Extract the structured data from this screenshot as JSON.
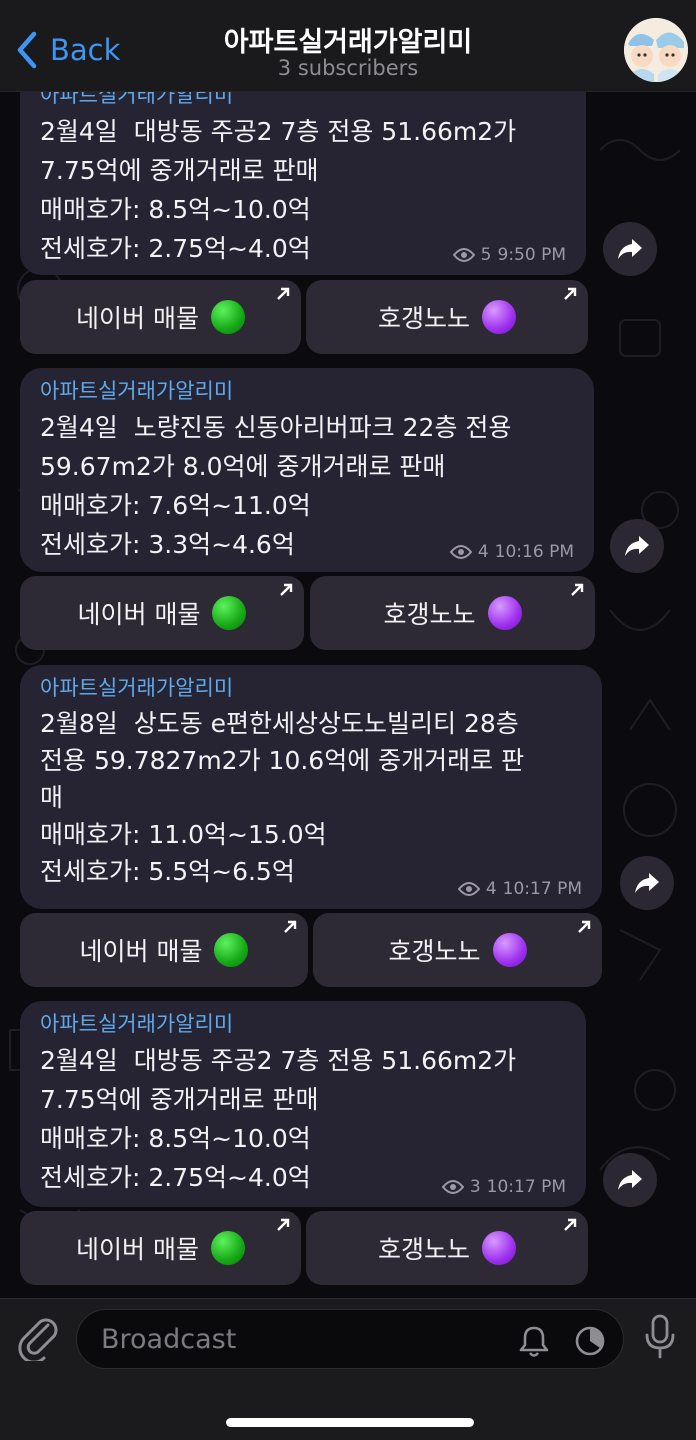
{
  "header": {
    "back_label": "Back",
    "title": "아파트실거래가알리미",
    "subtitle": "3 subscribers"
  },
  "messages": [
    {
      "author": "아파트실거래가알리미",
      "text": "2월4일  대방동 주공2 7층 전용 51.66m2가\n7.75억에 중개거래로 판매\n매매호가: 8.5억~10.0억\n전세호가: 2.75억~4.0억",
      "views": "5",
      "time": "9:50 PM",
      "buttons": [
        {
          "label": "네이버 매물",
          "dot": "green"
        },
        {
          "label": "호갱노노",
          "dot": "purple"
        }
      ]
    },
    {
      "author": "아파트실거래가알리미",
      "text": "2월4일  노량진동 신동아리버파크 22층 전용\n59.67m2가 8.0억에 중개거래로 판매\n매매호가: 7.6억~11.0억\n전세호가: 3.3억~4.6억",
      "views": "4",
      "time": "10:16 PM",
      "buttons": [
        {
          "label": "네이버 매물",
          "dot": "green"
        },
        {
          "label": "호갱노노",
          "dot": "purple"
        }
      ]
    },
    {
      "author": "아파트실거래가알리미",
      "text": "2월8일  상도동 e편한세상상도노빌리티 28층\n전용 59.7827m2가 10.6억에 중개거래로 판\n매\n매매호가: 11.0억~15.0억\n전세호가: 5.5억~6.5억",
      "views": "4",
      "time": "10:17 PM",
      "buttons": [
        {
          "label": "네이버 매물",
          "dot": "green"
        },
        {
          "label": "호갱노노",
          "dot": "purple"
        }
      ]
    },
    {
      "author": "아파트실거래가알리미",
      "text": "2월4일  대방동 주공2 7층 전용 51.66m2가\n7.75억에 중개거래로 판매\n매매호가: 8.5억~10.0억\n전세호가: 2.75억~4.0억",
      "views": "3",
      "time": "10:17 PM",
      "buttons": [
        {
          "label": "네이버 매물",
          "dot": "green"
        },
        {
          "label": "호갱노노",
          "dot": "purple"
        }
      ]
    }
  ],
  "composer": {
    "placeholder": "Broadcast"
  },
  "colors": {
    "accent": "#3e95f3",
    "author": "#5ea9ec",
    "bubble": "#262332",
    "button": "#2d2a36"
  },
  "icons": {
    "back": "chevron-left-icon",
    "views": "eye-icon",
    "forward": "share-arrow-icon",
    "link": "north-east-arrow-icon",
    "attach": "paperclip-icon",
    "bell": "bell-icon",
    "timer": "timer-icon",
    "mic": "microphone-icon"
  }
}
